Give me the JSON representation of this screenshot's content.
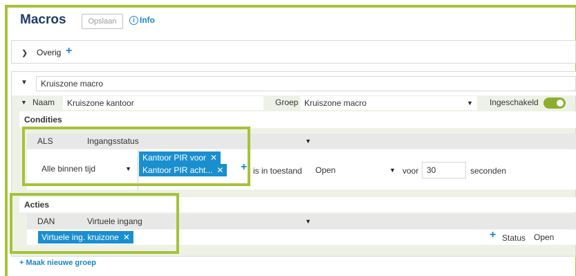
{
  "header": {
    "title": "Macros",
    "save_label": "Opslaan",
    "info_label": "Info",
    "info_icon": "info-icon"
  },
  "overig": {
    "label": "Overig",
    "chevron": "chevron-right-icon",
    "add": "+"
  },
  "group": {
    "chevron": "chevron-down-icon",
    "name_value": "Kruiszone macro",
    "macro": {
      "chevron": "chevron-down-icon",
      "naam_label": "Naam",
      "naam_value": "Kruiszone kantoor",
      "groep_label": "Groep",
      "groep_value": "Kruiszone macro",
      "ingeschakeld_label": "Ingeschakeld",
      "enabled": true
    },
    "condities": {
      "title": "Condities",
      "als_label": "ALS",
      "als_value": "Ingangsstatus",
      "timing_value": "Alle binnen tijd",
      "tags": [
        "Kantoor PIR voor",
        "Kantoor PIR acht..."
      ],
      "tag_remove": "✕",
      "add": "+",
      "state_label": "is in toestand",
      "state_value": "Open",
      "voor_label": "voor",
      "duration_value": "30",
      "unit_label": "seconden"
    },
    "acties": {
      "title": "Acties",
      "dan_label": "DAN",
      "dan_value": "Virtuele ingang",
      "tags": [
        "Virtuele ing. kruizone"
      ],
      "tag_remove": "✕",
      "add": "+",
      "status_label": "Status",
      "status_value": "Open"
    }
  },
  "footer": {
    "new_group_label": "+ Maak nieuwe groep"
  },
  "colors": {
    "accent": "#1a86c8",
    "highlight": "#a6c23b",
    "tag": "#1a8fd0",
    "toggle": "#8dae2d"
  }
}
